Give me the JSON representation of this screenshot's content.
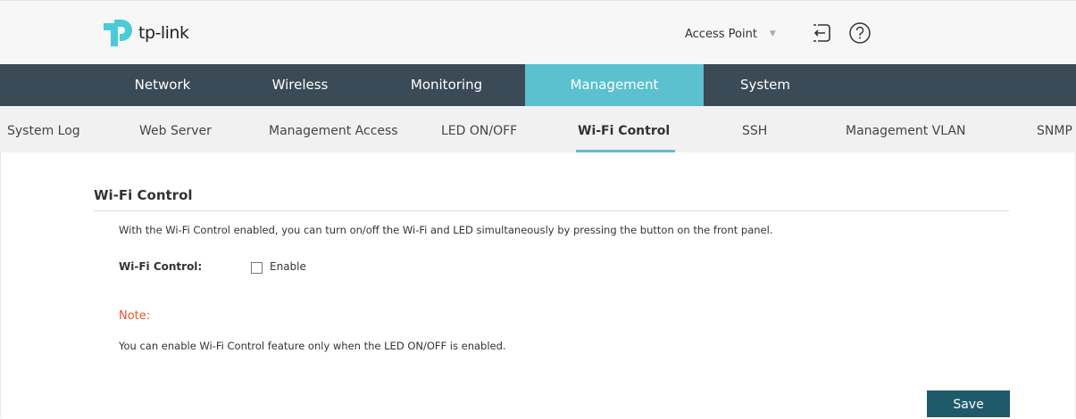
{
  "brand": {
    "name": "tp-link",
    "color": "#4acbd6"
  },
  "header": {
    "mode": "Access Point",
    "logout_icon": "logout-icon",
    "help_icon": "help-icon"
  },
  "main_nav": {
    "tabs": [
      {
        "label": "Network",
        "active": false
      },
      {
        "label": "Wireless",
        "active": false
      },
      {
        "label": "Monitoring",
        "active": false
      },
      {
        "label": "Management",
        "active": true
      },
      {
        "label": "System",
        "active": false
      }
    ],
    "bg_color": "#3a4a56",
    "active_color": "#5bc0cf"
  },
  "sub_nav": {
    "items": [
      {
        "label": "System Log",
        "active": false
      },
      {
        "label": "Web Server",
        "active": false
      },
      {
        "label": "Management Access",
        "active": false
      },
      {
        "label": "LED ON/OFF",
        "active": false
      },
      {
        "label": "Wi-Fi Control",
        "active": true
      },
      {
        "label": "SSH",
        "active": false
      },
      {
        "label": "Management VLAN",
        "active": false
      },
      {
        "label": "SNMP",
        "active": false
      }
    ]
  },
  "section": {
    "title": "Wi-Fi Control",
    "description": "With the Wi-Fi Control enabled, you can turn on/off the Wi-Fi and LED simultaneously by pressing the button on the front panel.",
    "field_label": "Wi-Fi Control:",
    "checkbox_label": "Enable",
    "checkbox_checked": false,
    "note_title": "Note:",
    "note_text": "You can enable Wi-Fi Control feature only when the LED ON/OFF is enabled.",
    "note_color": "#e8552e"
  },
  "actions": {
    "save_label": "Save",
    "save_color": "#1f5a6b"
  }
}
